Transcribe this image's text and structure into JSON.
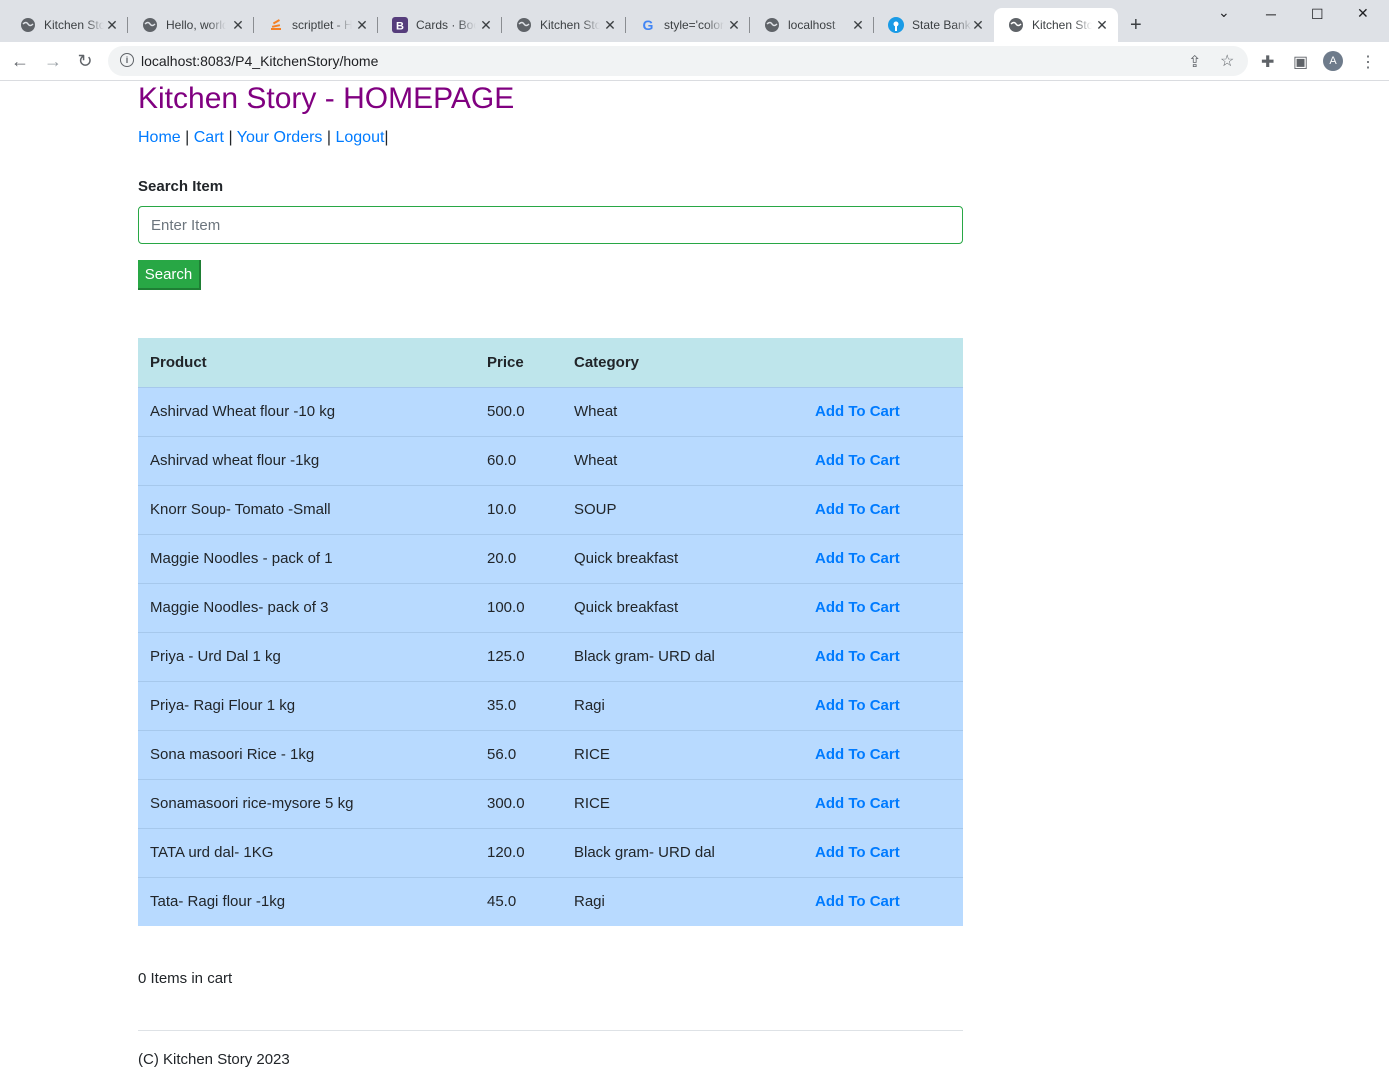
{
  "browser": {
    "tabs": [
      {
        "title": "Kitchen Story",
        "icon": "globe-icon"
      },
      {
        "title": "Hello, world!",
        "icon": "globe-icon"
      },
      {
        "title": "scriptlet - How",
        "icon": "stackoverflow-icon"
      },
      {
        "title": "Cards · Bootstrap",
        "icon": "bootstrap-icon"
      },
      {
        "title": "Kitchen Story",
        "icon": "globe-icon"
      },
      {
        "title": "style='color",
        "icon": "google-icon"
      },
      {
        "title": "localhost",
        "icon": "globe-icon"
      },
      {
        "title": "State Bank",
        "icon": "sbi-icon"
      },
      {
        "title": "Kitchen Story",
        "icon": "globe-icon",
        "active": true
      }
    ],
    "url": "localhost:8083/P4_KitchenStory/home",
    "avatar_letter": "A"
  },
  "page": {
    "title": "Kitchen Story - HOMEPAGE",
    "nav": {
      "home": "Home",
      "cart": "Cart",
      "orders": "Your Orders",
      "logout": "Logout",
      "sep": "|"
    },
    "search": {
      "label": "Search Item",
      "placeholder": "Enter Item",
      "button": "Search"
    },
    "table": {
      "headers": [
        "Product",
        "Price",
        "Category",
        ""
      ],
      "action_label": "Add To Cart",
      "rows": [
        {
          "product": "Ashirvad Wheat flour -10 kg",
          "price": "500.0",
          "category": "Wheat"
        },
        {
          "product": "Ashirvad wheat flour -1kg",
          "price": "60.0",
          "category": "Wheat"
        },
        {
          "product": "Knorr Soup- Tomato -Small",
          "price": "10.0",
          "category": "SOUP"
        },
        {
          "product": "Maggie Noodles - pack of 1",
          "price": "20.0",
          "category": "Quick breakfast"
        },
        {
          "product": "Maggie Noodles- pack of 3",
          "price": "100.0",
          "category": "Quick breakfast"
        },
        {
          "product": "Priya - Urd Dal 1 kg",
          "price": "125.0",
          "category": "Black gram- URD dal"
        },
        {
          "product": "Priya- Ragi Flour 1 kg",
          "price": "35.0",
          "category": "Ragi"
        },
        {
          "product": "Sona masoori Rice - 1kg",
          "price": "56.0",
          "category": "RICE"
        },
        {
          "product": "Sonamasoori rice-mysore 5 kg",
          "price": "300.0",
          "category": "RICE"
        },
        {
          "product": "TATA urd dal- 1KG",
          "price": "120.0",
          "category": "Black gram- URD dal"
        },
        {
          "product": "Tata- Ragi flour -1kg",
          "price": "45.0",
          "category": "Ragi"
        }
      ]
    },
    "cart_count_text": "0 Items in cart",
    "footer": "(C) Kitchen Story 2023"
  },
  "colors": {
    "title": "#800080",
    "link": "#007bff",
    "search_button": "#28a745",
    "header_row": "#bee5eb",
    "body_row": "#b8daff"
  }
}
